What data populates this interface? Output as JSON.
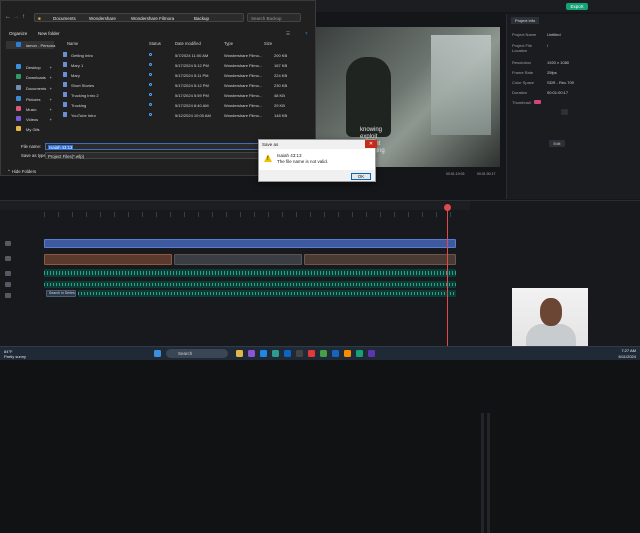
{
  "editor": {
    "export_label": "Export",
    "caption": "knowing\nexploit\nbrought\nengaging",
    "props": {
      "tab": "Project Info",
      "rows": [
        {
          "label": "Project Name",
          "value": "Untitled"
        },
        {
          "label": "Project File Location",
          "value": "/"
        },
        {
          "label": "Resolution",
          "value": "1920 x 1080"
        },
        {
          "label": "Frame Rate",
          "value": "25fps"
        },
        {
          "label": "Color Space",
          "value": "SDR - Rec.709"
        },
        {
          "label": "Duration",
          "value": "00:01:00:17"
        },
        {
          "label": "Thumbnail",
          "value": ""
        }
      ],
      "edit_label": "Edit"
    },
    "time_current": "00:01:19:03",
    "time_total": "00:01:00:17",
    "text_clip_label": "Search in Series"
  },
  "dialog": {
    "breadcrumb": [
      "Documents",
      "Wondershare",
      "Wondershare Filmora",
      "Backup"
    ],
    "search_placeholder": "Search Backup",
    "organize_label": "Organize",
    "new_folder_label": "New folder",
    "nav_items": [
      {
        "label": "lamon - Persona",
        "color": "#2f7fd8"
      },
      {
        "label": "Desktop",
        "color": "#3b8fe0"
      },
      {
        "label": "Downloads",
        "color": "#2f9a6c"
      },
      {
        "label": "Documents",
        "color": "#6e8fb3"
      },
      {
        "label": "Pictures",
        "color": "#3a8ad6"
      },
      {
        "label": "Music",
        "color": "#d95b7a"
      },
      {
        "label": "Videos",
        "color": "#7a5bd9"
      },
      {
        "label": "My Gifs",
        "color": "#e2b74a"
      }
    ],
    "columns": {
      "name": "Name",
      "status": "Status",
      "date": "Date modified",
      "type": "Type",
      "size": "Size"
    },
    "files": [
      {
        "name": "Getting Intro",
        "date": "5/7/2024 11:00 AM",
        "type": "Wondershare Filmo...",
        "size": "200 KB"
      },
      {
        "name": "Mary 1",
        "date": "5/17/2024 5:12 PM",
        "type": "Wondershare Filmo...",
        "size": "167 KB"
      },
      {
        "name": "Mary",
        "date": "5/17/2024 5:11 PM",
        "type": "Wondershare Filmo...",
        "size": "224 KB"
      },
      {
        "name": "Short Stories",
        "date": "5/17/2024 5:12 PM",
        "type": "Wondershare Filmo...",
        "size": "230 KB"
      },
      {
        "name": "Trucking Intro 2",
        "date": "5/17/2024 5:59 PM",
        "type": "Wondershare Filmo...",
        "size": "48 KB"
      },
      {
        "name": "Trucking",
        "date": "5/17/2024 8:40 AM",
        "type": "Wondershare Filmo...",
        "size": "29 KB"
      },
      {
        "name": "YouTube Intro",
        "date": "5/12/2024 10:00 AM",
        "type": "Wondershare Filmo...",
        "size": "148 KB"
      }
    ],
    "file_name_label": "File name:",
    "file_name_value": "Isaiah 43:13",
    "save_type_label": "Save as type:",
    "save_type_value": "Project Files(*.wfp)",
    "hide_folders_label": "Hide Folders"
  },
  "alert": {
    "title": "Save as",
    "line1": "Isaiah 43:13",
    "line2": "The file name is not valid.",
    "ok_label": "OK"
  },
  "taskbar": {
    "weather_temp": "84°F",
    "weather_desc": "Partly sunny",
    "search_label": "Search",
    "time": "7:27 AM",
    "date": "6/11/2024"
  }
}
